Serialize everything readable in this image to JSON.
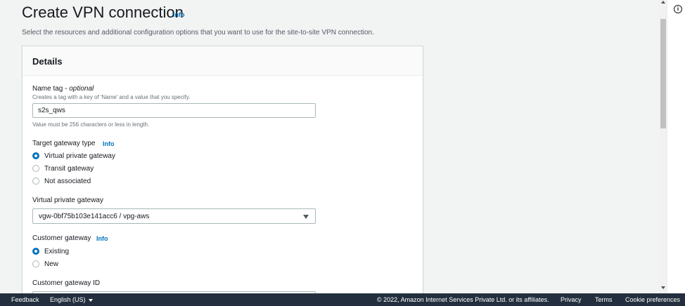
{
  "header": {
    "title": "Create VPN connection",
    "info": "Info",
    "description": "Select the resources and additional configuration options that you want to use for the site-to-site VPN connection."
  },
  "details": {
    "title": "Details",
    "name_tag": {
      "label": "Name tag - ",
      "optional": "optional",
      "hint": "Creates a tag with a key of 'Name' and a value that you specify.",
      "value": "s2s_qws",
      "constraint": "Value must be 256 characters or less in length."
    },
    "target_gateway_type": {
      "label": "Target gateway type",
      "info": "Info",
      "options": [
        "Virtual private gateway",
        "Transit gateway",
        "Not associated"
      ],
      "selected": "Virtual private gateway"
    },
    "virtual_private_gateway": {
      "label": "Virtual private gateway",
      "value": "vgw-0bf75b103e141acc6 / vpg-aws"
    },
    "customer_gateway": {
      "label": "Customer gateway",
      "info": "Info",
      "options": [
        "Existing",
        "New"
      ],
      "selected": "Existing"
    },
    "customer_gateway_id": {
      "label": "Customer gateway ID"
    }
  },
  "footer": {
    "feedback": "Feedback",
    "language": "English (US)",
    "copyright": "© 2022, Amazon Internet Services Private Ltd. or its affiliates.",
    "privacy": "Privacy",
    "terms": "Terms",
    "cookie_preferences": "Cookie preferences"
  },
  "icons": {
    "help_panel": "info-circle-icon"
  },
  "colors": {
    "link": "#0073bb",
    "footer_bg": "#232f3e",
    "page_bg": "#f2f3f3"
  }
}
